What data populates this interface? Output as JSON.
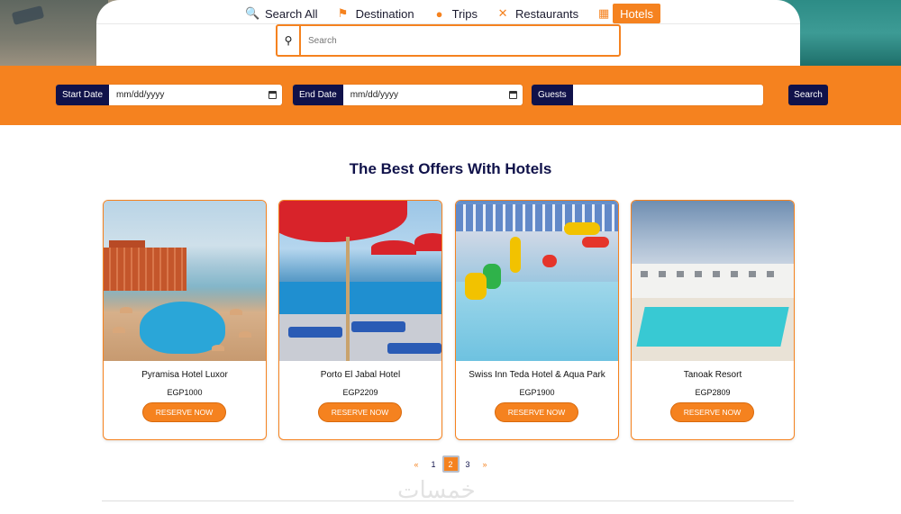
{
  "nav": {
    "items": [
      {
        "label": "Search All",
        "icon": "search-key-icon"
      },
      {
        "label": "Destination",
        "icon": "location-pin-icon"
      },
      {
        "label": "Trips",
        "icon": "globe-icon"
      },
      {
        "label": "Restaurants",
        "icon": "utensils-icon"
      },
      {
        "label": "Hotels",
        "icon": "hotel-icon",
        "active": true
      }
    ]
  },
  "search": {
    "placeholder": "Search"
  },
  "filters": {
    "start_label": "Start Date",
    "start_value": "mm/dd/yyyy",
    "end_label": "End Date",
    "end_value": "mm/dd/yyyy",
    "guests_label": "Guests",
    "guests_value": "",
    "submit_label": "Search"
  },
  "offers": {
    "title": "The Best Offers With Hotels",
    "reserve_label": "RESERVE NOW",
    "hotels": [
      {
        "name": "Pyramisa Hotel Luxor",
        "price": "EGP1000"
      },
      {
        "name": "Porto El Jabal Hotel",
        "price": "EGP2209"
      },
      {
        "name": "Swiss Inn Teda Hotel & Aqua Park",
        "price": "EGP1900"
      },
      {
        "name": "Tanoak Resort",
        "price": "EGP2809"
      }
    ]
  },
  "pagination": {
    "prev": "«",
    "pages": [
      "1",
      "2",
      "3"
    ],
    "current": "2",
    "next": "»"
  },
  "watermark": "خمسات",
  "colors": {
    "accent": "#f5821f",
    "navy": "#10124a"
  }
}
